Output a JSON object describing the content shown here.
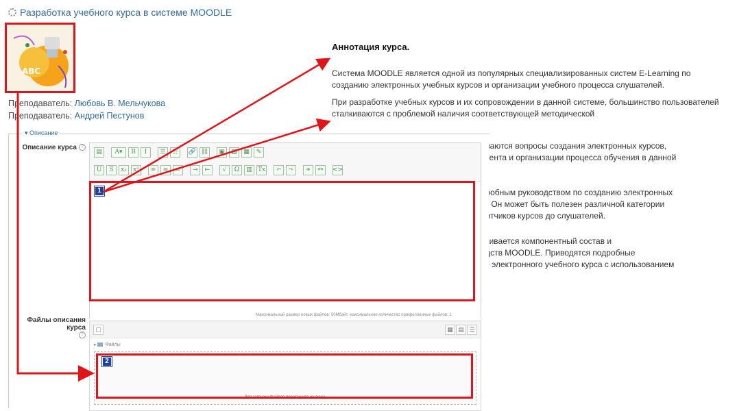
{
  "course": {
    "title": "Разработка учебного курса в системе MOODLE",
    "title_icon": "gear-icon"
  },
  "teachers": [
    {
      "role": "Преподаватель: ",
      "name": "Любовь В. Мельчукова"
    },
    {
      "role": "Преподаватель: ",
      "name": "Андрей Пестунов"
    }
  ],
  "annotation": {
    "heading": "Аннотация курса.",
    "paragraphs": [
      "Система MOODLE является одной из популярных специализированных систем E-Learning по созданию электронных учебных курсов и организации учебного процесса слушателей.",
      "При разработке учебных курсов и их сопровождении в данной системе, большинство пользователей сталкиваются с проблемой наличия соответствующей методической",
      "риваются вопросы создания электронных курсов,",
      "онтента и организации процесса обучения в данной",
      "одробным руководством по созданию электронных",
      "LE. Он может быть полезен различной категории",
      "аботчиков курсов до слушателей.",
      "атривается компонентный состав и",
      "редств MOODLE. Приводятся подробные",
      "йке электронного учебного курса с использованием"
    ]
  },
  "form": {
    "legend": "Описание",
    "description_label": "Описание курса",
    "files_label_line1": "Файлы описания",
    "files_label_line2": "курса",
    "max_size_text": "Максимальный размер новых файлов: 50Мбайт, максимальное количество прикрепленных файлов: 1",
    "files_path": "Файлы",
    "drop_text": "Для загрузки файлов перетащите их сюда."
  },
  "callouts": {
    "badge1": "1",
    "badge2": "2",
    "color": "#e0151a",
    "badge_color": "#1e3fa8"
  },
  "editor_toolbar": {
    "row1": [
      "▤",
      "A▾",
      "B",
      "I",
      "☰",
      "☷",
      "🔗",
      "⛓",
      "▣",
      "▨",
      "▦",
      "✎"
    ],
    "row2": [
      "U",
      "S",
      "x₂",
      "x²",
      "≡",
      "≡",
      "≡",
      "⇥",
      "⇤",
      "√",
      "Ω",
      "▥",
      "Tx",
      "↶",
      "↷",
      "⚭",
      "⚯",
      "<>"
    ]
  }
}
